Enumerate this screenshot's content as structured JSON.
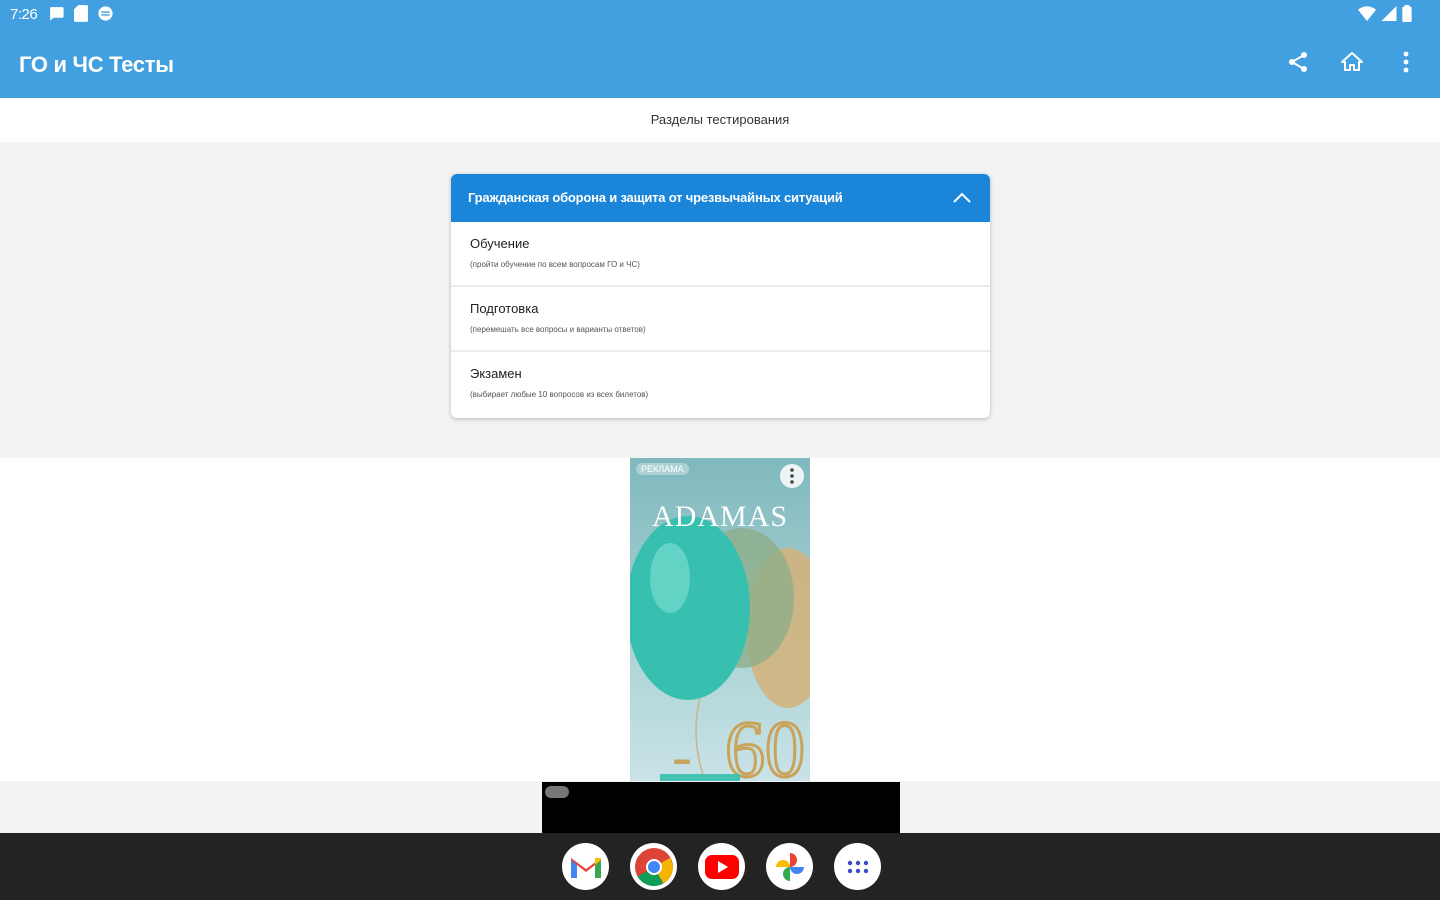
{
  "status_bar": {
    "time": "7:26"
  },
  "app_bar": {
    "title": "ГО и ЧС Тесты",
    "color": "#42a0e1"
  },
  "section_header": "Разделы тестирования",
  "card": {
    "title": "Гражданская оборона и защита от чрезвычайных ситуаций",
    "header_color": "#1b86d9",
    "items": [
      {
        "title": "Обучение",
        "subtitle": "(пройти обучение по всем вопросам ГО и ЧС)"
      },
      {
        "title": "Подготовка",
        "subtitle": "(перемешать все вопросы и варианты ответов)"
      },
      {
        "title": "Экзамен",
        "subtitle": "(выбирает любые 10 вопросов из всех билетов)"
      }
    ]
  },
  "ad": {
    "label": "РЕКЛАМА",
    "brand": "ADAMAS"
  },
  "dock": {
    "apps": [
      "gmail-icon",
      "chrome-icon",
      "youtube-icon",
      "photos-icon",
      "app-drawer-icon"
    ]
  }
}
